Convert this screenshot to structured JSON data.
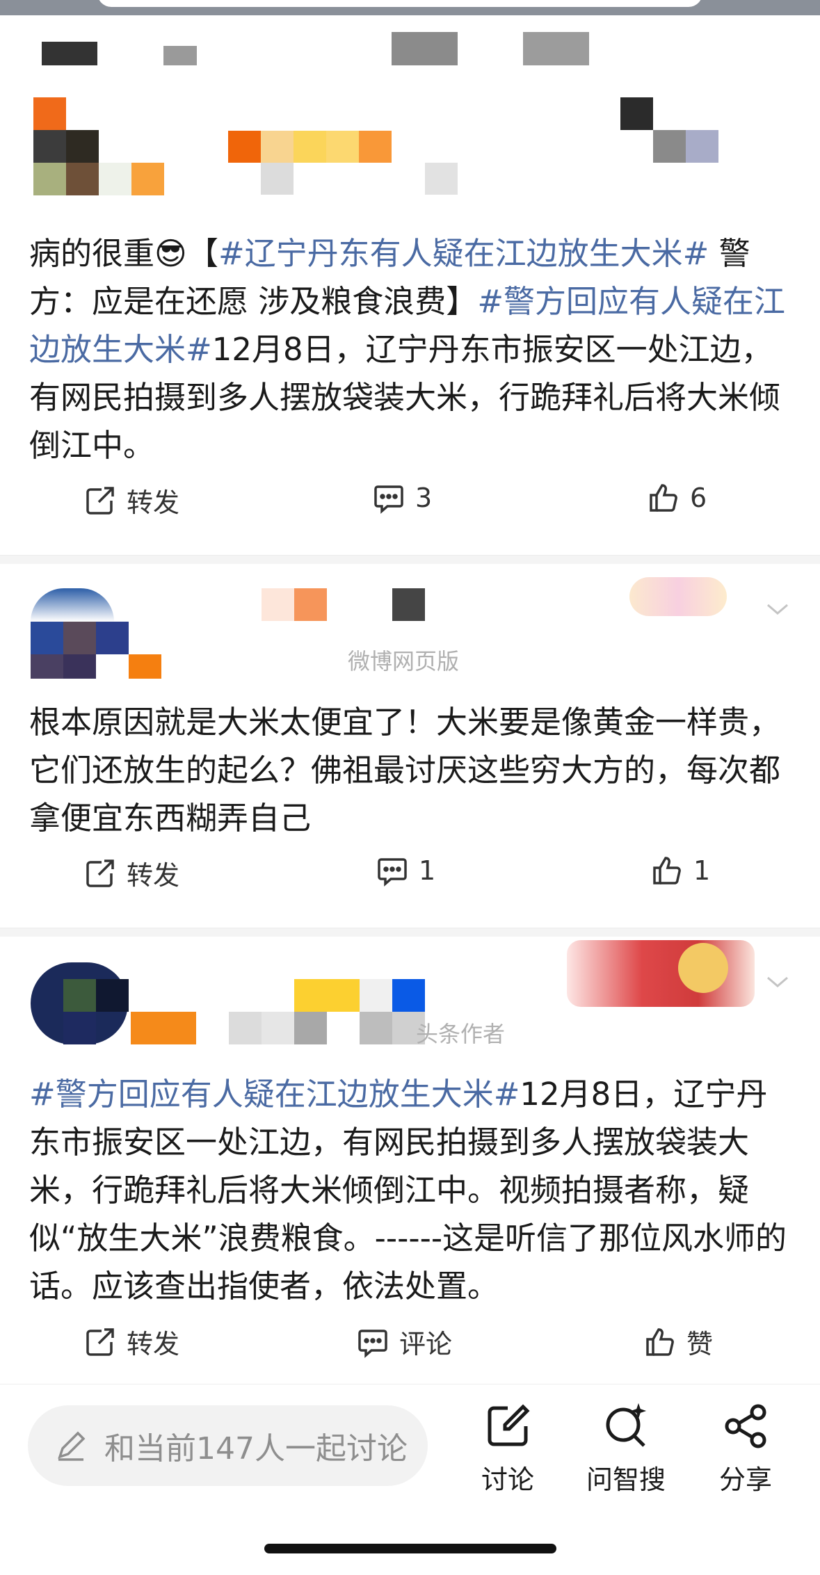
{
  "posts": [
    {
      "text_plain_1": "病的很重",
      "emoji": "😎",
      "bracket_open": "【",
      "tag1": "#辽宁丹东有人疑在江边放生大米#",
      "text_plain_2": " 警方：应是在还愿 涉及粮食浪费】",
      "tag2": "#警方回应有人疑在江边放生大米#",
      "text_plain_3": "12月8日，辽宁丹东市振安区一处江边，有网民拍摄到多人摆放袋装大米，行跪拜礼后将大米倾倒江中。",
      "repost_label": "转发",
      "comment_count": "3",
      "like_count": "6"
    },
    {
      "source_partial": "微博网页版",
      "text": "根本原因就是大米太便宜了！大米要是像黄金一样贵，它们还放生的起么？佛祖最讨厌这些穷大方的，每次都拿便宜东西糊弄自己",
      "repost_label": "转发",
      "comment_count": "1",
      "like_count": "1"
    },
    {
      "source_partial": "头条作者",
      "tag": "#警方回应有人疑在江边放生大米#",
      "text": "12月8日，辽宁丹东市振安区一处江边，有网民拍摄到多人摆放袋装大米，行跪拜礼后将大米倾倒江中。视频拍摄者称，疑似“放生大米”浪费粮食。------这是听信了那位风水师的话。应该查出指使者，依法处置。",
      "repost_label": "转发",
      "comment_label": "评论",
      "like_label": "赞"
    }
  ],
  "bottom_bar": {
    "discuss_placeholder": "和当前147人一起讨论",
    "tools": [
      {
        "label": "讨论",
        "icon": "edit-icon"
      },
      {
        "label": "问智搜",
        "icon": "ai-search-icon"
      },
      {
        "label": "分享",
        "icon": "share-icon"
      }
    ]
  },
  "colors": {
    "hashtag": "#4a6aa3",
    "text": "#1a1a1a",
    "muted": "#8e8e8e"
  }
}
